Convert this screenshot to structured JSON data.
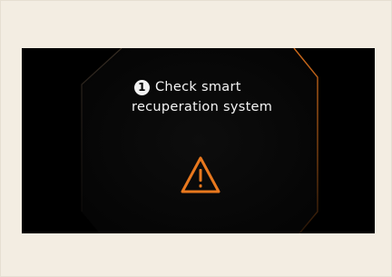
{
  "display": {
    "badge_number": "1",
    "message_line1": "Check smart",
    "message_line2": "recuperation system",
    "warning_icon": "warning-triangle-icon",
    "colors": {
      "background": "#f3ede2",
      "screen": "#000000",
      "accent": "#e8781e",
      "text": "#f4f4f4"
    }
  }
}
